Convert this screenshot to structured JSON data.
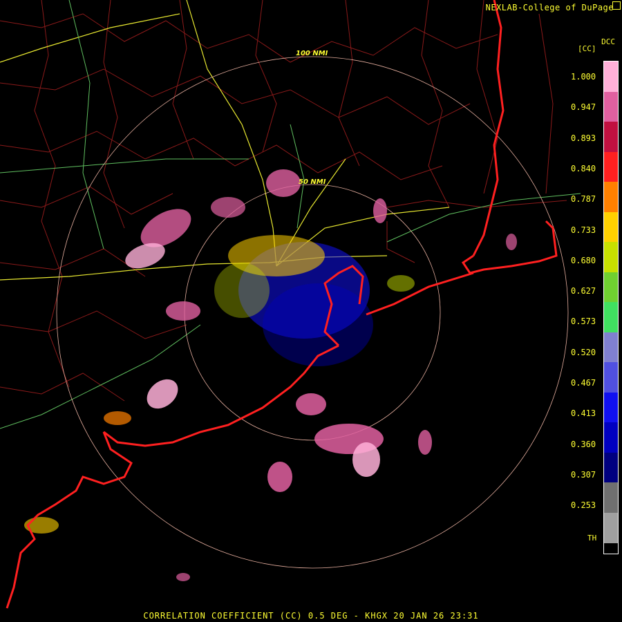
{
  "header": {
    "credit": "NEXLAB-College of DuPage",
    "legend_code": "DCC",
    "legend_unit": "[CC]"
  },
  "legend": {
    "ticks": [
      "1.000",
      "0.947",
      "0.893",
      "0.840",
      "0.787",
      "0.733",
      "0.680",
      "0.627",
      "0.573",
      "0.520",
      "0.467",
      "0.413",
      "0.360",
      "0.307",
      "0.253"
    ],
    "threshold_label": "TH",
    "colors": [
      "#ffb0d8",
      "#e060a0",
      "#c01040",
      "#ff2020",
      "#ff8000",
      "#ffd000",
      "#c8e000",
      "#70d030",
      "#40e060",
      "#8080d0",
      "#5050e0",
      "#1010f0",
      "#0000c0",
      "#000080",
      "#707070",
      "#a0a0a0"
    ]
  },
  "map": {
    "ring_labels": [
      "100 NMI",
      "50 NMI"
    ],
    "colors": {
      "county_lines": "#8b1a1a",
      "highways": "#e8e830",
      "interstate_green": "#60c060",
      "coastline": "#ff2020",
      "range_rings": "#e8b0a0"
    }
  },
  "footer": {
    "caption": "CORRELATION COEFFICIENT (CC) 0.5 DEG - KHGX 20 JAN 26 23:31"
  }
}
